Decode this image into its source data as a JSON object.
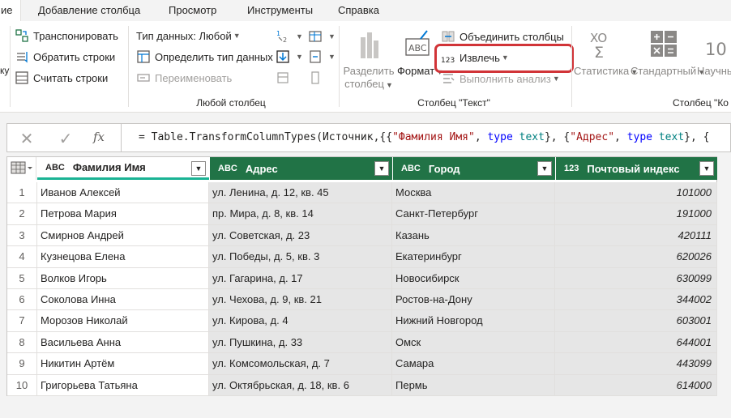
{
  "menu": {
    "tabs": [
      {
        "label": "ие",
        "active": true
      },
      {
        "label": "Добавление столбца",
        "active": false
      },
      {
        "label": "Просмотр",
        "active": false
      },
      {
        "label": "Инструменты",
        "active": false
      },
      {
        "label": "Справка",
        "active": false
      }
    ]
  },
  "ribbon": {
    "left_cut": "ку",
    "transpose": "Транспонировать",
    "reverse_rows": "Обратить строки",
    "count_rows": "Считать строки",
    "data_type": "Тип данных: Любой",
    "detect_type": "Определить тип данных",
    "rename": "Переименовать",
    "group_any_column": "Любой столбец",
    "split_column_line1": "Разделить",
    "split_column_line2": "столбец",
    "format": "Формат",
    "merge_columns": "Объединить столбцы",
    "extract": "Извлечь",
    "analyze": "Выполнить анализ",
    "group_text_column": "Столбец \"Текст\"",
    "statistics": "Статистика",
    "standard": "Стандартный",
    "scientific": "Научный",
    "group_number_column": "Столбец \"Ко",
    "sort_icon_label": "2",
    "abc_icon_label": "ABC",
    "num123_icon_label": "123",
    "sigma_icon_label": "XO",
    "ten_icon_label": "10"
  },
  "formula": {
    "prefix": "= Table.TransformColumnTypes(Источник,{{",
    "s1": "\"Фамилия Имя\"",
    "mid1": ", ",
    "kw1": "type",
    "t1": " text",
    "mid2": "}, {",
    "s2": "\"Адрес\"",
    "mid3": ", ",
    "kw2": "type",
    "t2": " text",
    "tail": "}, {"
  },
  "table": {
    "columns": [
      {
        "type": "ABC",
        "name": "Фамилия Имя"
      },
      {
        "type": "ABC",
        "name": "Адрес"
      },
      {
        "type": "ABC",
        "name": "Город"
      },
      {
        "type": "123",
        "name": "Почтовый индекс"
      }
    ],
    "rows": [
      {
        "n": "1",
        "name": "Иванов Алексей",
        "addr": "ул. Ленина, д. 12, кв. 45",
        "city": "Москва",
        "zip": "101000"
      },
      {
        "n": "2",
        "name": "Петрова Мария",
        "addr": "пр. Мира, д. 8, кв. 14",
        "city": "Санкт-Петербург",
        "zip": "191000"
      },
      {
        "n": "3",
        "name": "Смирнов Андрей",
        "addr": "ул. Советская, д. 23",
        "city": "Казань",
        "zip": "420111"
      },
      {
        "n": "4",
        "name": "Кузнецова Елена",
        "addr": "ул. Победы, д. 5, кв. 3",
        "city": "Екатеринбург",
        "zip": "620026"
      },
      {
        "n": "5",
        "name": "Волков Игорь",
        "addr": "ул. Гагарина, д. 17",
        "city": "Новосибирск",
        "zip": "630099"
      },
      {
        "n": "6",
        "name": "Соколова Инна",
        "addr": "ул. Чехова, д. 9, кв. 21",
        "city": "Ростов-на-Дону",
        "zip": "344002"
      },
      {
        "n": "7",
        "name": "Морозов Николай",
        "addr": "ул. Кирова, д. 4",
        "city": "Нижний Новгород",
        "zip": "603001"
      },
      {
        "n": "8",
        "name": "Васильева Анна",
        "addr": "ул. Пушкина, д. 33",
        "city": "Омск",
        "zip": "644001"
      },
      {
        "n": "9",
        "name": "Никитин Артём",
        "addr": "ул. Комсомольская, д. 7",
        "city": "Самара",
        "zip": "443099"
      },
      {
        "n": "10",
        "name": "Григорьева Татьяна",
        "addr": "ул. Октябрьская, д. 18, кв. 6",
        "city": "Пермь",
        "zip": "614000"
      }
    ]
  },
  "colors": {
    "header_green": "#217346",
    "accent_teal": "#1ab394",
    "highlight_red": "#d13438"
  }
}
